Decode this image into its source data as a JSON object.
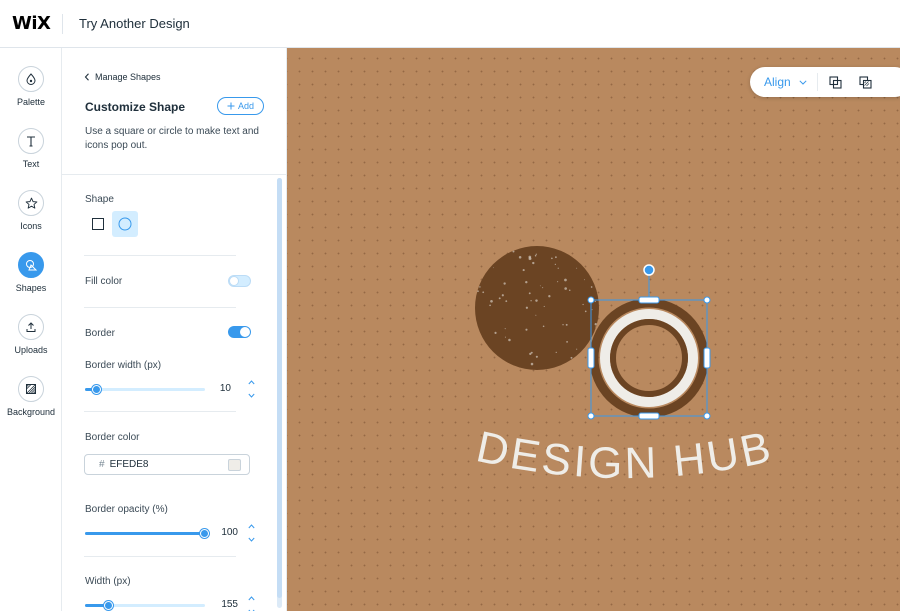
{
  "app": {
    "logo": "WiX",
    "title": "Try Another Design"
  },
  "rail": {
    "items": [
      {
        "label": "Palette",
        "icon": "palette-drop-icon"
      },
      {
        "label": "Text",
        "icon": "text-T-icon"
      },
      {
        "label": "Icons",
        "icon": "star-icon"
      },
      {
        "label": "Shapes",
        "icon": "shapes-icon",
        "active": true
      },
      {
        "label": "Uploads",
        "icon": "upload-icon"
      },
      {
        "label": "Background",
        "icon": "background-hatch-icon"
      }
    ]
  },
  "panel": {
    "back_label": "Manage Shapes",
    "title": "Customize Shape",
    "add_label": "Add",
    "description": "Use a square or circle to make text and icons pop out.",
    "shape_label": "Shape",
    "shape_options": [
      "square",
      "circle"
    ],
    "shape_selected": "circle",
    "fill_color_label": "Fill color",
    "fill_color_enabled": false,
    "border_label": "Border",
    "border_enabled": true,
    "border_width_label": "Border width (px)",
    "border_width_value": "10",
    "border_width_fraction": 0.1,
    "border_color_label": "Border color",
    "border_color_hash": "#",
    "border_color_value": "EFEDE8",
    "border_color_swatch": "#EFEDE8",
    "border_opacity_label": "Border opacity (%)",
    "border_opacity_value": "100",
    "border_opacity_fraction": 1.0,
    "width_label": "Width (px)",
    "width_value": "155",
    "width_fraction": 0.2
  },
  "canvas": {
    "background_color": "#B9895F",
    "align_label": "Align",
    "logo_text": "DESIGN HUB",
    "logo_dark_color": "#6B4423",
    "logo_light_color": "#EFEDE8"
  },
  "colors": {
    "accent": "#3899EC"
  }
}
